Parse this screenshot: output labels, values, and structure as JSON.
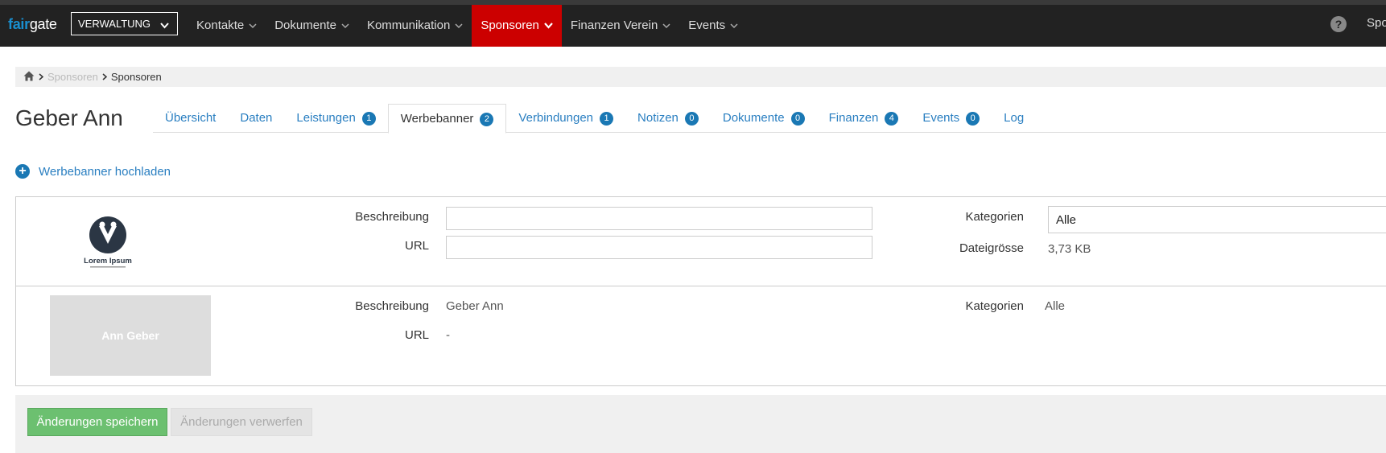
{
  "app": {
    "logo_fair": "fair",
    "logo_gate": "gate",
    "area": "VERWALTUNG",
    "nav": [
      {
        "label": "Kontakte"
      },
      {
        "label": "Dokumente"
      },
      {
        "label": "Kommunikation"
      },
      {
        "label": "Sponsoren"
      },
      {
        "label": "Finanzen Verein"
      },
      {
        "label": "Events"
      }
    ],
    "help": "?",
    "user": "Spo"
  },
  "breadcrumb": {
    "parent": "Sponsoren",
    "current": "Sponsoren"
  },
  "page": {
    "title": "Geber Ann"
  },
  "tabs": [
    {
      "label": "Übersicht",
      "badge": ""
    },
    {
      "label": "Daten",
      "badge": ""
    },
    {
      "label": "Leistungen",
      "badge": "1"
    },
    {
      "label": "Werbebanner",
      "badge": "2"
    },
    {
      "label": "Verbindungen",
      "badge": "1"
    },
    {
      "label": "Notizen",
      "badge": "0"
    },
    {
      "label": "Dokumente",
      "badge": "0"
    },
    {
      "label": "Finanzen",
      "badge": "4"
    },
    {
      "label": "Events",
      "badge": "0"
    },
    {
      "label": "Log",
      "badge": ""
    }
  ],
  "upload": {
    "label": "Werbebanner hochladen"
  },
  "banners": [
    {
      "logo_text": "Lorem Ipsum",
      "description_label": "Beschreibung",
      "description_value": "",
      "url_label": "URL",
      "url_value": "",
      "categories_label": "Kategorien",
      "categories_value": "Alle",
      "filesize_label": "Dateigrösse",
      "filesize_value": "3,73 KB"
    },
    {
      "image_text": "Ann Geber",
      "description_label": "Beschreibung",
      "description_value": "Geber Ann",
      "url_label": "URL",
      "url_value": "-",
      "categories_label": "Kategorien",
      "categories_value": "Alle"
    }
  ],
  "footer": {
    "save": "Änderungen speichern",
    "discard": "Änderungen verwerfen"
  },
  "colors": {
    "active_nav": "#cc0000",
    "link": "#2a7fc1",
    "badge": "#1a78b4",
    "save": "#6cc070"
  }
}
